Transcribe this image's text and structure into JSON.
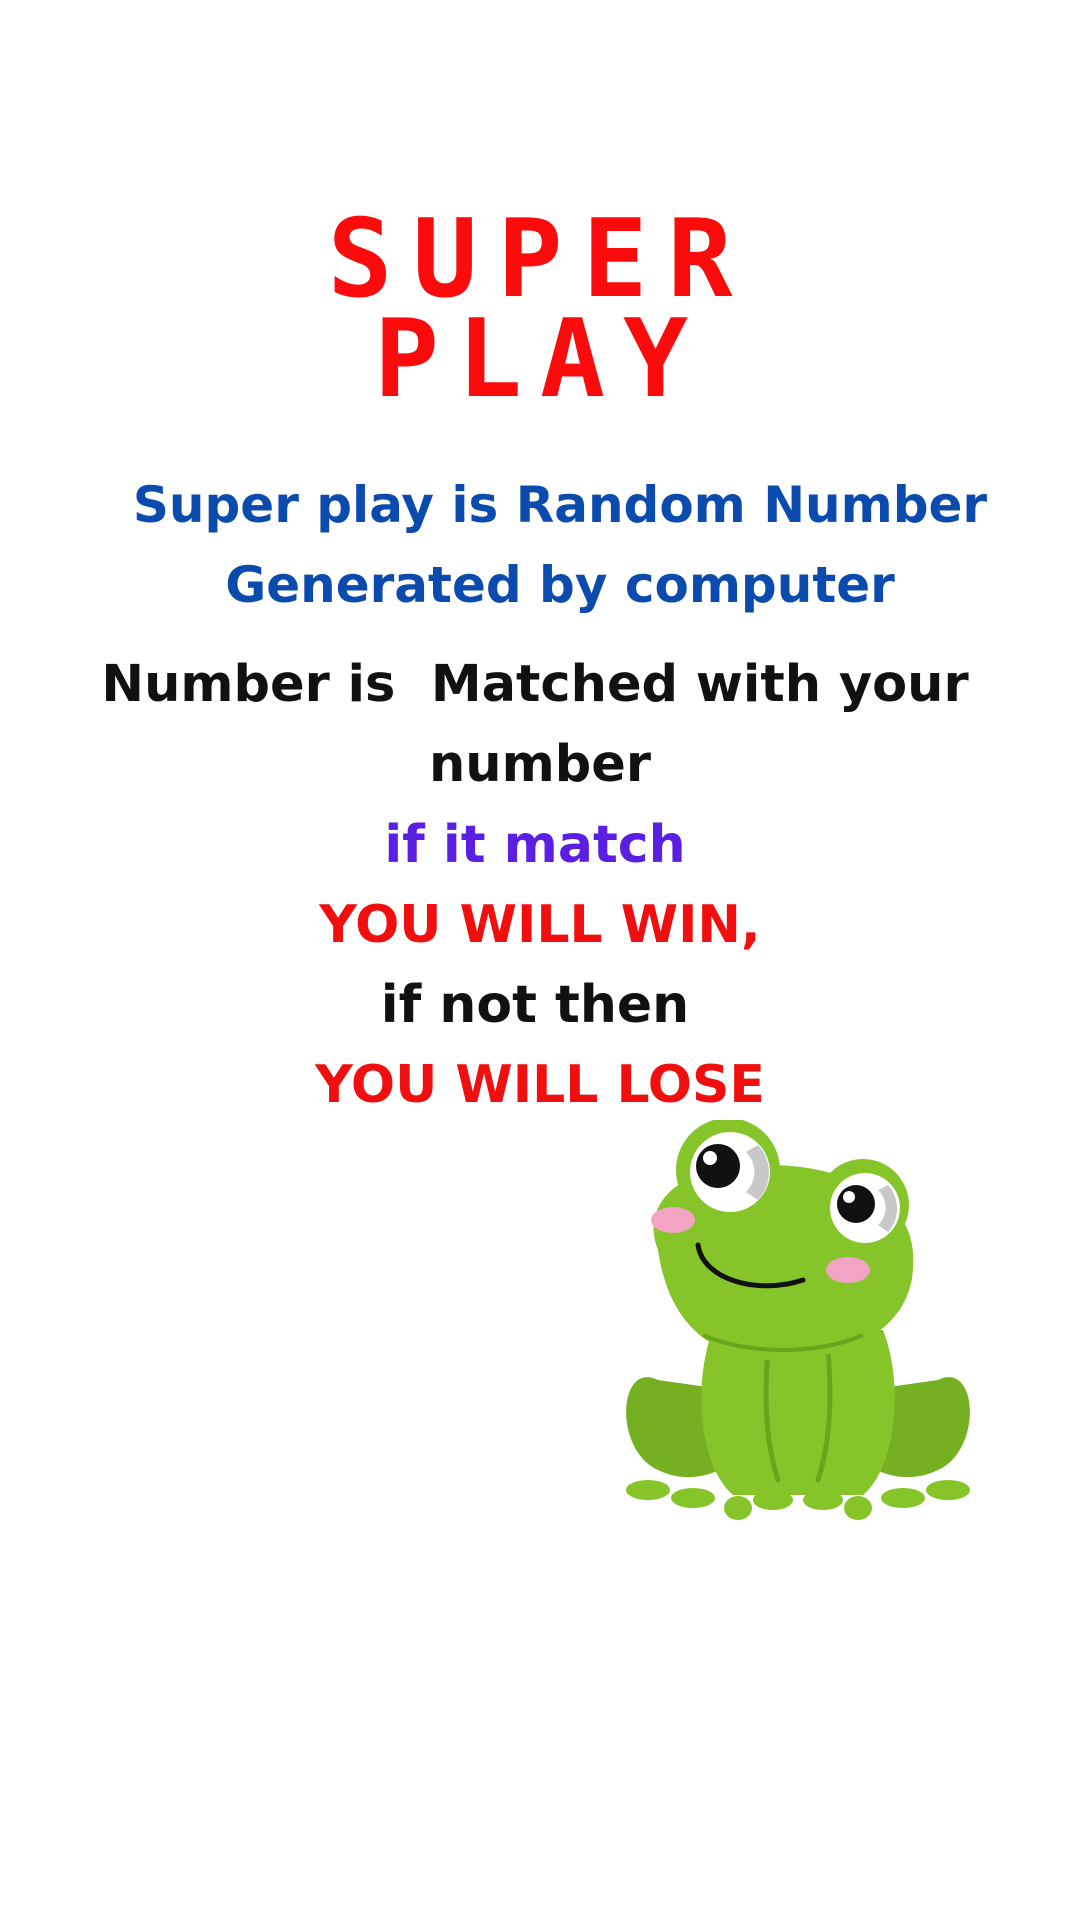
{
  "title": {
    "line1": "SUPER",
    "line2": "PLAY"
  },
  "intro": {
    "line1": "Super play is Random Number",
    "line2": "Generated by computer"
  },
  "rule": {
    "line1": "Number is  Matched with your",
    "line2": "number"
  },
  "condition_match": "if it match",
  "result_win": "YOU WILL WIN,",
  "condition_not": "if not then",
  "result_lose": "YOU WILL LOSE",
  "illustration": {
    "icon": "frog-icon"
  },
  "colors": {
    "title": "#fb0b0c",
    "intro": "#0a4bad",
    "body": "#111111",
    "match": "#5a1fe2",
    "result": "#f00e0e",
    "frog_body": "#86c52a",
    "background": "#ffffff"
  }
}
